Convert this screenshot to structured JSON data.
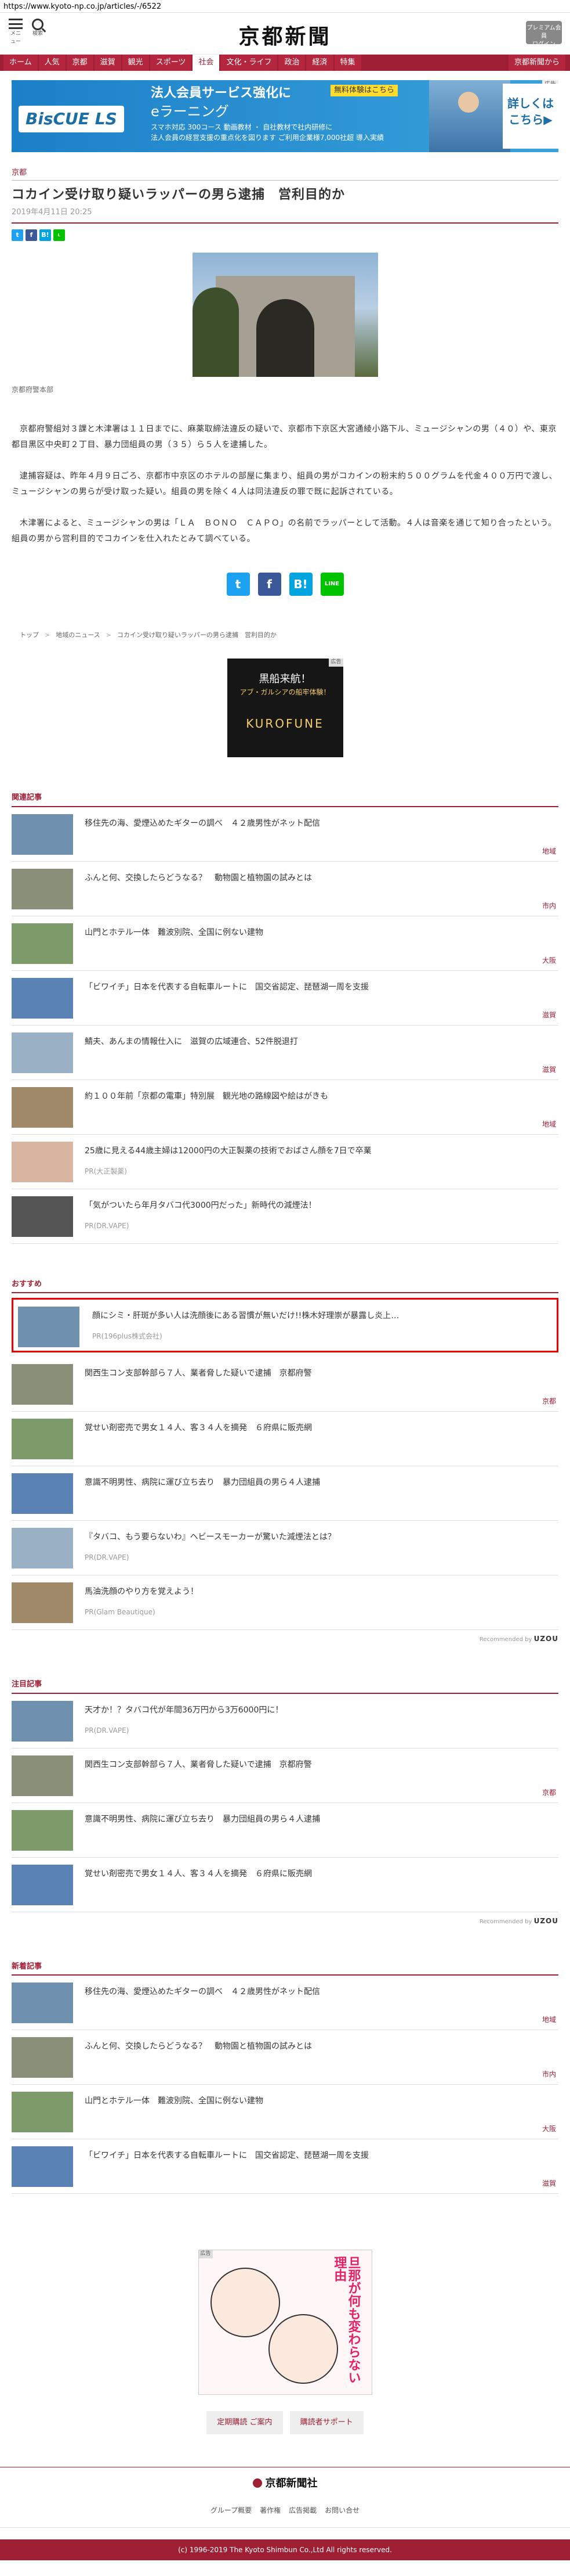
{
  "url": "https://www.kyoto-np.co.jp/articles/-/6522",
  "header": {
    "logo": "京都新聞",
    "menu_label": "メニュー",
    "search_label": "検索",
    "premium": "プレミアム会員\nログイン"
  },
  "nav": [
    "ホーム",
    "人気",
    "京都",
    "滋賀",
    "観光",
    "スポーツ",
    "社会",
    "文化・ライフ",
    "政治",
    "経済",
    "特集",
    "京都新聞から"
  ],
  "nav_active": 6,
  "banner": {
    "ad": "広告",
    "brand": "BisCUE LS",
    "line1": "法人会員サービス強化に",
    "line2": "eラーニング",
    "line3": "スマホ対応 300コース 動画教材 ・ 自社教材で社内研修に\n法人会員の経営支援の重点化を図ります  ご利用企業様7,000社超 導入実績",
    "badge": "無料体験はこちら",
    "cta": "詳しくは\nこちら▶"
  },
  "article": {
    "category": "京都",
    "title": "コカイン受け取り疑いラッパーの男ら逮捕　営利目的か",
    "date": "2019年4月11日 20:25",
    "caption": "京都府警本部",
    "paragraphs": [
      "京都府警組対３課と木津署は１１日までに、麻薬取締法違反の疑いで、京都市下京区大宮通綾小路下ル、ミュージシャンの男（４０）や、東京都目黒区中央町２丁目、暴力団組員の男（３５）ら５人を逮捕した。",
      "逮捕容疑は、昨年４月９日ごろ、京都市中京区のホテルの部屋に集まり、組員の男がコカインの粉末約５００グラムを代金４００万円で渡し、ミュージシャンの男らが受け取った疑い。組員の男を除く４人は同法違反の罪で既に起訴されている。",
      "木津署によると、ミュージシャンの男は「ＬＡ　ＢＯＮＯ　ＣＡＰＯ」の名前でラッパーとして活動。４人は音楽を通じて知り合ったという。組員の男から営利目的でコカインを仕入れたとみて調べている。"
    ]
  },
  "share": {
    "tw": "t",
    "fb": "f",
    "hb": "B!",
    "ln": "LINE"
  },
  "breadcrumbs": [
    "トップ",
    "地域のニュース",
    "コカイン受け取り疑いラッパーの男ら逮捕　営利目的か"
  ],
  "mid_ad": {
    "ad": "広告",
    "l1": "黒船来航！",
    "l2": "アブ・ガルシアの船牢体験！",
    "l3": "KUROFUNE"
  },
  "related": {
    "title": "関連記事",
    "items": [
      {
        "text": "移住先の海、愛煙込めたギターの調べ　４２歳男性がネット配信",
        "tag": "地域",
        "pr": ""
      },
      {
        "text": "ふんと何、交換したらどうなる？　動物園と植物園の試みとは",
        "tag": "市内",
        "pr": ""
      },
      {
        "text": "山門とホテル一体　難波別院、全国に例ない建物",
        "tag": "大阪",
        "pr": ""
      },
      {
        "text": "「ビワイチ」日本を代表する自転車ルートに　国交省認定、琵琶湖一周を支援",
        "tag": "滋賀",
        "pr": ""
      },
      {
        "text": "鯖夫、あんまの情報仕入に　滋賀の広域連合、52件脱退打",
        "tag": "滋賀",
        "pr": ""
      },
      {
        "text": "約１００年前「京都の電車」特別展　観光地の路線図や絵はがきも",
        "tag": "地域",
        "pr": ""
      },
      {
        "text": "25歳に見える44歳主婦は12000円の大正製薬の技術でおばさん顔を7日で卒業",
        "tag": "",
        "pr": "PR(大正製薬)"
      },
      {
        "text": "「気がついたら年月タバコ代3000円だった」新時代の減煙法！",
        "tag": "",
        "pr": "PR(DR.VAPE)"
      }
    ]
  },
  "recommended": {
    "title": "おすすめ",
    "items": [
      {
        "text": "顔にシミ・肝斑が多い人は洗顔後にある習慣が無いだけ!!株木好理崇が暴露し炎上…",
        "tag": "",
        "pr": "PR(196plus株式会社)"
      },
      {
        "text": "関西生コン支部幹部ら７人、業者脅した疑いで逮捕　京都府警",
        "tag": "京都",
        "pr": ""
      },
      {
        "text": "覚せい剤密売で男女１４人、客３４人を摘発　６府県に販売網",
        "tag": "",
        "pr": ""
      },
      {
        "text": "意識不明男性、病院に運び立ち去り　暴力団組員の男ら４人逮捕",
        "tag": "",
        "pr": ""
      },
      {
        "text": "『タバコ、もう要らないわ』ヘビースモーカーが驚いた減煙法とは？",
        "tag": "",
        "pr": "PR(DR.VAPE)"
      },
      {
        "text": "馬油洗顔のやり方を覚えよう！",
        "tag": "",
        "pr": "PR(Glam Beautique)"
      }
    ],
    "powered": "Recommended by",
    "powered_brand": "UZOU"
  },
  "popular": {
    "title": "注目記事",
    "items": [
      {
        "text": "天才か！？タバコ代が年間36万円から3万6000円に！",
        "tag": "",
        "pr": "PR(DR.VAPE)"
      },
      {
        "text": "関西生コン支部幹部ら７人、業者脅した疑いで逮捕　京都府警",
        "tag": "京都",
        "pr": ""
      },
      {
        "text": "意識不明男性、病院に運び立ち去り　暴力団組員の男ら４人逮捕",
        "tag": "",
        "pr": ""
      },
      {
        "text": "覚せい剤密売で男女１４人、客３４人を摘発　６府県に販売網",
        "tag": "",
        "pr": ""
      }
    ],
    "powered": "Recommended by",
    "powered_brand": "UZOU"
  },
  "latest": {
    "title": "新着記事",
    "items": [
      {
        "text": "移住先の海、愛煙込めたギターの調べ　４２歳男性がネット配信",
        "tag": "地域",
        "pr": ""
      },
      {
        "text": "ふんと何、交換したらどうなる？　動物園と植物園の試みとは",
        "tag": "市内",
        "pr": ""
      },
      {
        "text": "山門とホテル一体　難波別院、全国に例ない建物",
        "tag": "大阪",
        "pr": ""
      },
      {
        "text": "「ビワイチ」日本を代表する自転車ルートに　国交省認定、琵琶湖一周を支援",
        "tag": "滋賀",
        "pr": ""
      }
    ]
  },
  "bottom_ad": {
    "ad": "広告",
    "text": "旦那が何も変わらない理由"
  },
  "buttons": [
    "定期購読 ご案内",
    "購読者サポート"
  ],
  "footer": {
    "logo": "京都新聞社",
    "links": [
      "グループ概要",
      "著作権",
      "広告掲載",
      "お問い合せ"
    ],
    "copyright": "(c) 1996-2019 The Kyoto Shimbun Co.,Ltd All rights reserved."
  },
  "colors": {
    "brand": "#9e1f34",
    "highlight": "#ee0000"
  }
}
